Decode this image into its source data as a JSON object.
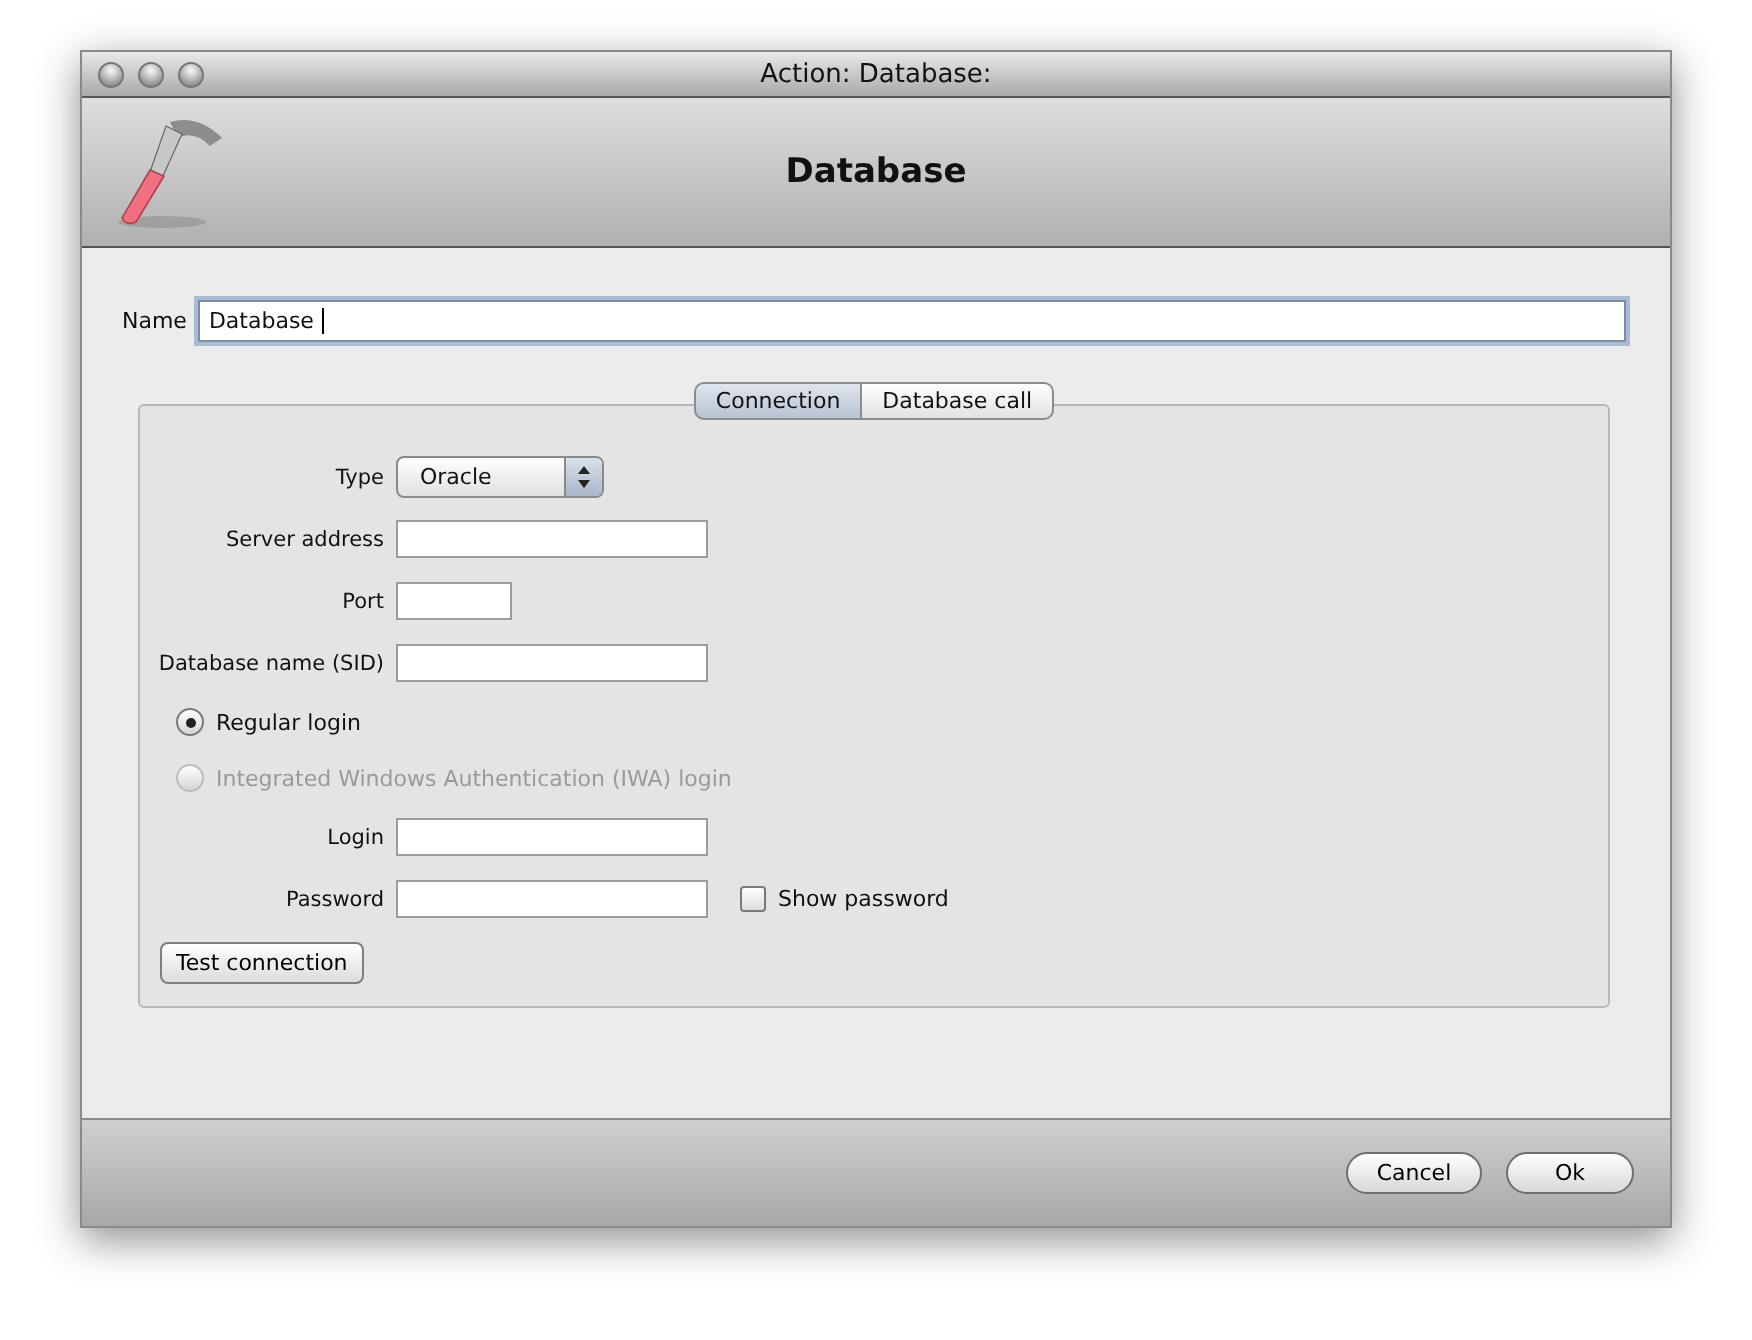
{
  "window": {
    "title": "Action: Database:"
  },
  "header": {
    "title": "Database"
  },
  "name_field": {
    "label": "Name",
    "value": "Database"
  },
  "tabs": [
    {
      "label": "Connection",
      "selected": true
    },
    {
      "label": "Database call",
      "selected": false
    }
  ],
  "form": [
    {
      "kind": "select",
      "label": "Type",
      "value": "Oracle"
    },
    {
      "kind": "field",
      "label": "Server address"
    },
    {
      "kind": "short-field",
      "label": "Port"
    },
    {
      "kind": "field",
      "label": "Database name (SID)"
    },
    {
      "kind": "radio",
      "label": "Regular login",
      "selected": true,
      "disabled": false
    },
    {
      "kind": "radio",
      "label": "Integrated Windows Authentication (IWA) login",
      "selected": false,
      "disabled": true
    },
    {
      "kind": "field",
      "label": "Login"
    },
    {
      "kind": "field",
      "label": "Password",
      "checkbox": {
        "label": "Show password",
        "checked": false
      }
    },
    {
      "kind": "button",
      "label": "Test connection"
    }
  ],
  "buttons": [
    "Cancel",
    "Ok"
  ]
}
